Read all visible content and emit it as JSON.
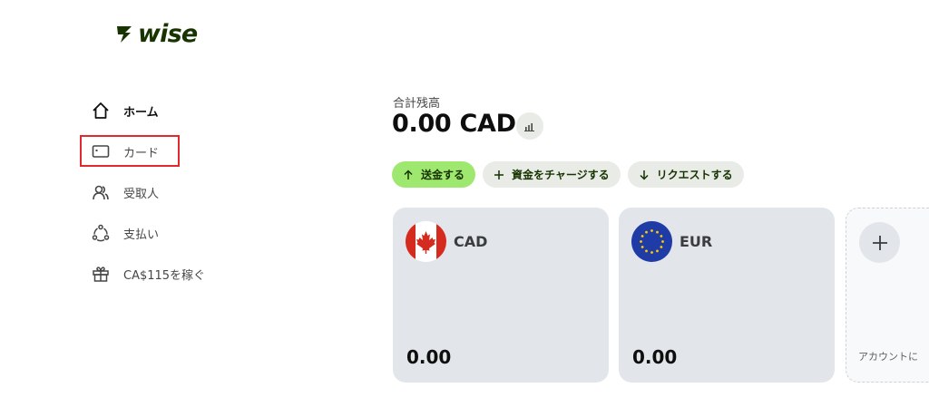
{
  "brand": {
    "name": "wise",
    "color": "#163300"
  },
  "sidebar": {
    "items": [
      {
        "label": "ホーム",
        "icon": "home-icon",
        "active": true
      },
      {
        "label": "カード",
        "icon": "card-icon",
        "highlighted": true
      },
      {
        "label": "受取人",
        "icon": "recipients-icon"
      },
      {
        "label": "支払い",
        "icon": "payments-icon"
      },
      {
        "label": "CA$115を稼ぐ",
        "icon": "gift-icon"
      }
    ],
    "highlight_color": "#e0282e"
  },
  "main": {
    "balance_label": "合計残高",
    "balance_amount": "0.00 CAD",
    "actions": [
      {
        "label": "送金する",
        "icon": "arrow-up-icon",
        "primary": true
      },
      {
        "label": "資金をチャージする",
        "icon": "plus-icon"
      },
      {
        "label": "リクエストする",
        "icon": "arrow-down-icon"
      }
    ],
    "accounts": [
      {
        "code": "CAD",
        "amount": "0.00",
        "flag": "canada-flag-icon"
      },
      {
        "code": "EUR",
        "amount": "0.00",
        "flag": "eu-flag-icon"
      }
    ],
    "add_account": {
      "label": "アカウントに",
      "icon": "plus-icon"
    }
  },
  "colors": {
    "primary_green": "#9fe870",
    "card_bg": "#e2e6eb",
    "pill_bg": "#e8ebe6"
  }
}
